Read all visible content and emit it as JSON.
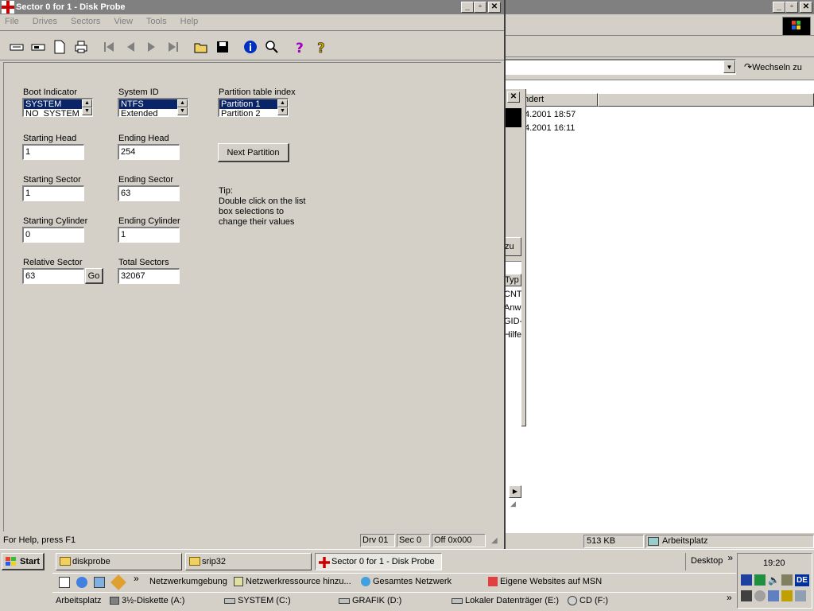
{
  "window": {
    "title": "Sector 0 for 1 - Disk Probe",
    "minimize": "_",
    "maximize": "▫",
    "close": "✕",
    "menu": [
      "File",
      "Drives",
      "Sectors",
      "View",
      "Tools",
      "Help"
    ]
  },
  "toolbar": {
    "icons": [
      "open-volume-icon",
      "read-sector-icon",
      "new-document-icon",
      "print-icon",
      "first-sector-icon",
      "previous-sector-icon",
      "next-sector-icon",
      "last-sector-icon",
      "open-file-icon",
      "save-icon",
      "info-icon",
      "search-icon",
      "help-icon",
      "context-help-icon"
    ]
  },
  "form": {
    "boot_indicator_label": "Boot Indicator",
    "boot_indicator_options": [
      "SYSTEM",
      "NO_SYSTEM"
    ],
    "system_id_label": "System ID",
    "system_id_options": [
      "NTFS",
      "Extended"
    ],
    "partition_index_label": "Partition table index",
    "partition_index_options": [
      "Partition 1",
      "Partition 2"
    ],
    "starting_head_label": "Starting Head",
    "starting_head": "1",
    "ending_head_label": "Ending Head",
    "ending_head": "254",
    "next_partition": "Next Partition",
    "starting_sector_label": "Starting Sector",
    "starting_sector": "1",
    "ending_sector_label": "Ending Sector",
    "ending_sector": "63",
    "tip_title": "Tip:",
    "tip_line1": "Double click on the list",
    "tip_line2": "box selections to",
    "tip_line3": "change their values",
    "starting_cylinder_label": "Starting Cylinder",
    "starting_cylinder": "0",
    "ending_cylinder_label": "Ending Cylinder",
    "ending_cylinder": "1",
    "relative_sector_label": "Relative Sector",
    "relative_sector": "63",
    "go_button": "Go",
    "total_sectors_label": "Total Sectors",
    "total_sectors": "32067"
  },
  "status": {
    "help": "For Help, press F1",
    "drive": "Drv  01",
    "sector": "Sec 0",
    "offset": "Off 0x000"
  },
  "explorer": {
    "go_button": "Wechseln zu",
    "column_modified": "ndert",
    "rows": [
      {
        "date": "4.2001 18:57"
      },
      {
        "date": "4.2001 16:11"
      }
    ],
    "status_size": "513 KB",
    "status_location": "Arbeitsplatz"
  },
  "inner_window": {
    "button": "zu",
    "col_type": "Typ",
    "types": [
      "CNT-",
      "Anwe",
      "GID-",
      "Hilfe"
    ]
  },
  "taskbar": {
    "start": "Start",
    "tasks": [
      {
        "label": "diskprobe"
      },
      {
        "label": "srip32"
      },
      {
        "label": "Sector 0 for 1 - Disk Probe"
      }
    ],
    "desktop": "Desktop",
    "chevron": "»",
    "clock": "19:20",
    "quick_links": [
      "Netzwerkumgebung",
      "Netzwerkressource hinzu...",
      "Gesamtes Netzwerk",
      "Eigene Websites auf MSN"
    ],
    "drives_bar": [
      "Arbeitsplatz",
      "3½-Diskette (A:)",
      "SYSTEM (C:)",
      "GRAFIK (D:)",
      "Lokaler Datenträger (E:)",
      "CD (F:)"
    ],
    "tray_lang": "DE"
  }
}
